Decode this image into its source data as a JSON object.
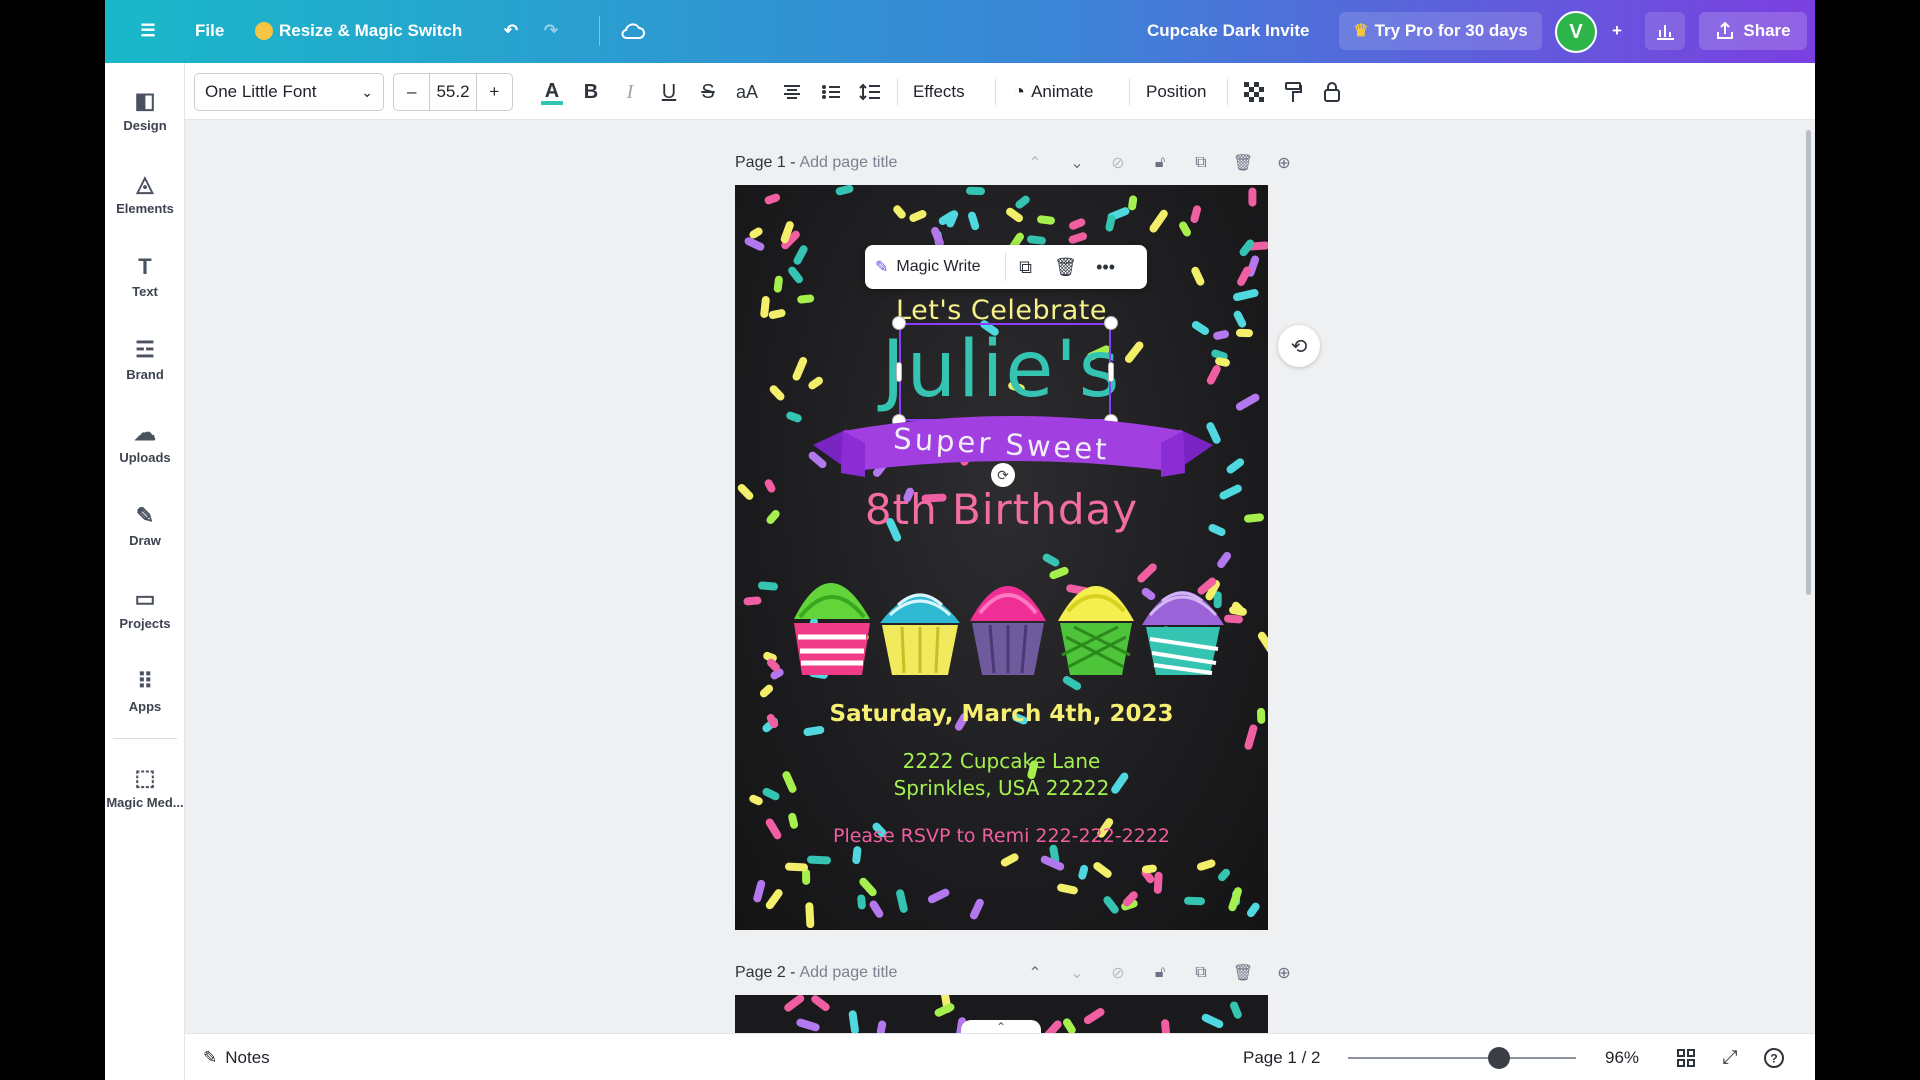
{
  "topbar": {
    "file_label": "File",
    "resize_label": "Resize & Magic Switch",
    "doc_title": "Cupcake Dark Invite",
    "pro_label": "Try Pro for 30 days",
    "avatar_letter": "V",
    "share_label": "Share"
  },
  "sidebar": {
    "items": [
      {
        "label": "Design",
        "icon": "design-icon",
        "glyph": "◧"
      },
      {
        "label": "Elements",
        "icon": "elements-icon",
        "glyph": "◬"
      },
      {
        "label": "Text",
        "icon": "text-icon",
        "glyph": "T"
      },
      {
        "label": "Brand",
        "icon": "brand-icon",
        "glyph": "☲"
      },
      {
        "label": "Uploads",
        "icon": "uploads-icon",
        "glyph": "☁"
      },
      {
        "label": "Draw",
        "icon": "draw-icon",
        "glyph": "✎"
      },
      {
        "label": "Projects",
        "icon": "projects-icon",
        "glyph": "▭"
      },
      {
        "label": "Apps",
        "icon": "apps-icon",
        "glyph": "⠿"
      },
      {
        "label": "Magic Med...",
        "icon": "magic-media-icon",
        "glyph": "⬚"
      }
    ]
  },
  "format": {
    "font_name": "One Little Font",
    "font_size": "55.2",
    "effects_label": "Effects",
    "animate_label": "Animate",
    "position_label": "Position",
    "text_color": "#2ec4b6"
  },
  "pages": {
    "page1_label": "Page 1 -",
    "page1_placeholder": "Add page title",
    "page2_label": "Page 2 -",
    "page2_placeholder": "Add page title"
  },
  "magic_bar": {
    "magic_write_label": "Magic Write"
  },
  "invite": {
    "lets_celebrate": "Let's Celebrate",
    "name": "Julie's",
    "super_sweet": "Super Sweet",
    "birthday": "8th Birthday",
    "date": "Saturday, March 4th, 2023",
    "address_line1": "2222 Cupcake Lane",
    "address_line2": "Sprinkles, USA 22222",
    "rsvp": "Please RSVP to Remi 222-222-2222"
  },
  "bottombar": {
    "notes_label": "Notes",
    "page_indicator": "Page 1 / 2",
    "zoom_label": "96%",
    "zoom_value": 96
  },
  "colors": {
    "ribbon": "#a13fe0",
    "name_teal": "#35c3b2",
    "selection": "#8b3dff"
  }
}
